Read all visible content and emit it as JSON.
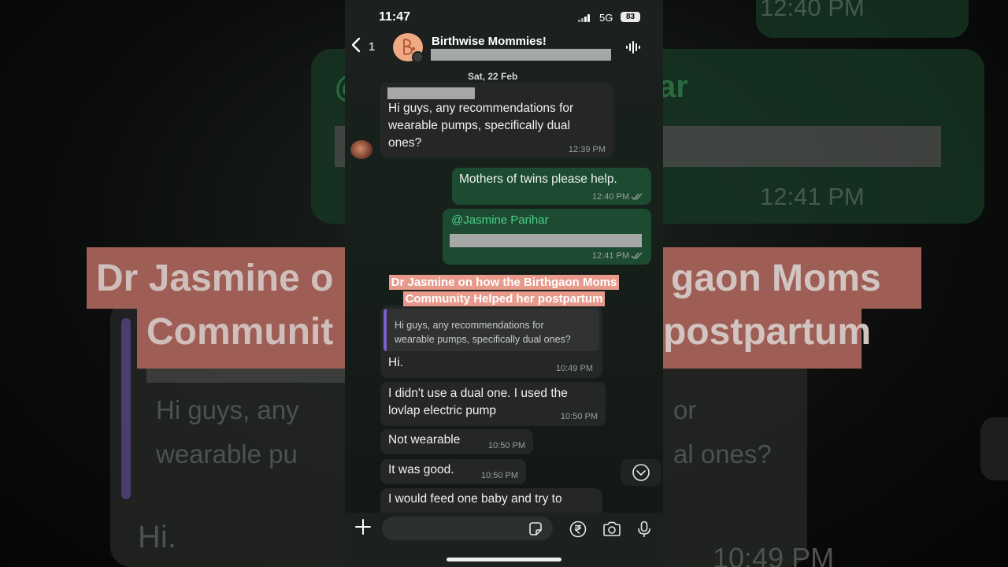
{
  "status": {
    "time": "11:47",
    "network": "5G",
    "battery": "83"
  },
  "header": {
    "back_count": "1",
    "group_name": "Birthwise Mommies!"
  },
  "date_chip": "Sat, 22 Feb",
  "messages": [
    {
      "direction": "in",
      "text": "Hi guys, any recommendations for\nwearable pumps, specifically dual\nones?",
      "time": "12:39 PM"
    },
    {
      "direction": "out",
      "text": "Mothers of twins please help.",
      "time": "12:40 PM"
    },
    {
      "direction": "out",
      "mention": "@Jasmine Parihar",
      "time": "12:41 PM"
    },
    {
      "direction": "in",
      "quote": "Hi guys, any recommendations for\nwearable pumps, specifically dual ones?",
      "text": "Hi.",
      "time": "10:49 PM"
    },
    {
      "direction": "in",
      "text": "I didn't use a dual one. I used the\nlovlap electric pump",
      "time": "10:50 PM"
    },
    {
      "direction": "in",
      "text": "Not wearable",
      "time": "10:50 PM"
    },
    {
      "direction": "in",
      "text": "It was good.",
      "time": "10:50 PM"
    },
    {
      "direction": "in",
      "text": "I would feed one baby and try to",
      "time": ""
    }
  ],
  "caption": "Dr Jasmine on how the Birthgaon Moms Community Helped her postpartum",
  "background": {
    "texts": [
      "12:40 PM",
      "@J",
      "ar",
      "12:41 PM",
      "Hi guys, any",
      "or",
      "wearable pu",
      "al ones?",
      "Hi.",
      "10:49 PM"
    ],
    "caption_left_1": "Dr Jasmine o",
    "caption_right_1": "gaon Moms",
    "caption_left_2": "Communit",
    "caption_right_2": "postpartum"
  },
  "colors": {
    "outgoing_bubble": "#1c4b31",
    "incoming_bubble": "#242726",
    "mention": "#4ccf86",
    "caption_bg": "#e79a8c",
    "quote_bar": "#7c5fd0"
  },
  "icons": [
    "back-chevron-icon",
    "voice-wave-icon",
    "double-check-icon",
    "chevron-down-icon",
    "plus-icon",
    "sticker-icon",
    "rupee-icon",
    "camera-icon",
    "microphone-icon"
  ]
}
